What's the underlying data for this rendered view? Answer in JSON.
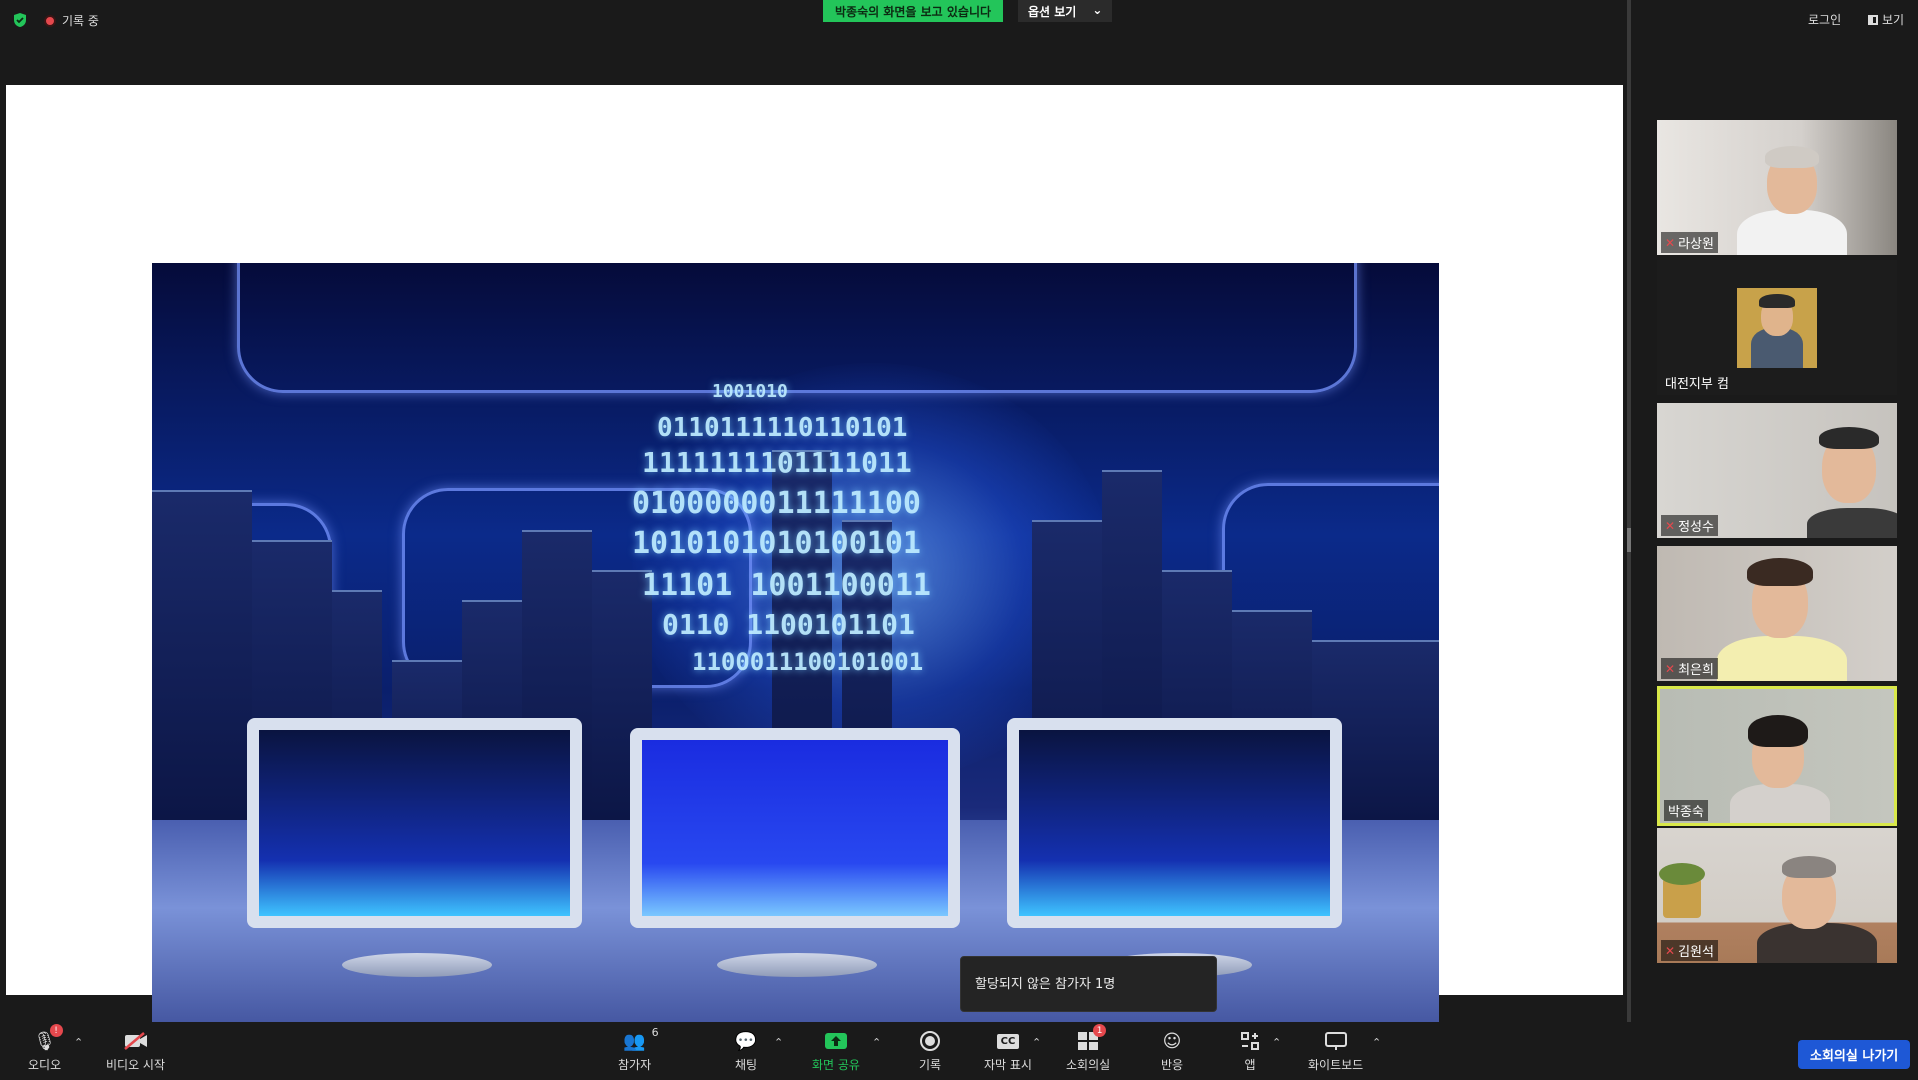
{
  "topbar": {
    "recording_label": "기록 중",
    "share_banner": "박종숙의 화면을 보고 있습니다",
    "view_options": "옵션 보기",
    "login": "로그인",
    "view": "보기"
  },
  "participants": [
    {
      "name": "라상원",
      "muted": true
    },
    {
      "name": "대전지부 컴",
      "muted": false
    },
    {
      "name": "정성수",
      "muted": true
    },
    {
      "name": "최은희",
      "muted": true
    },
    {
      "name": "박종숙",
      "muted": false,
      "active": true
    },
    {
      "name": "김원석",
      "muted": true
    }
  ],
  "slide": {
    "binary_lines": [
      "1001010",
      "0110111110110101",
      "1111111101111011",
      "0100000011111100",
      "1010101010100101",
      "11101 1001100011",
      "0110 1100101101",
      "1100011100101001"
    ]
  },
  "popup": {
    "text": "할당되지 않은 참가자 1명"
  },
  "toolbar": {
    "audio": "오디오",
    "audio_badge": "!",
    "video": "비디오 시작",
    "participants": "참가자",
    "participants_count": "6",
    "chat": "채팅",
    "share": "화면 공유",
    "record": "기록",
    "captions": "자막 표시",
    "captions_icon": "CC",
    "breakout": "소회의실",
    "breakout_badge": "1",
    "reactions": "반응",
    "apps": "앱",
    "whiteboard": "화이트보드",
    "leave": "소회의실 나가기"
  },
  "colors": {
    "accent_green": "#23c55a",
    "active_border": "#d9e84a",
    "leave_blue": "#1e58d6",
    "mute_red": "#e5484d"
  }
}
